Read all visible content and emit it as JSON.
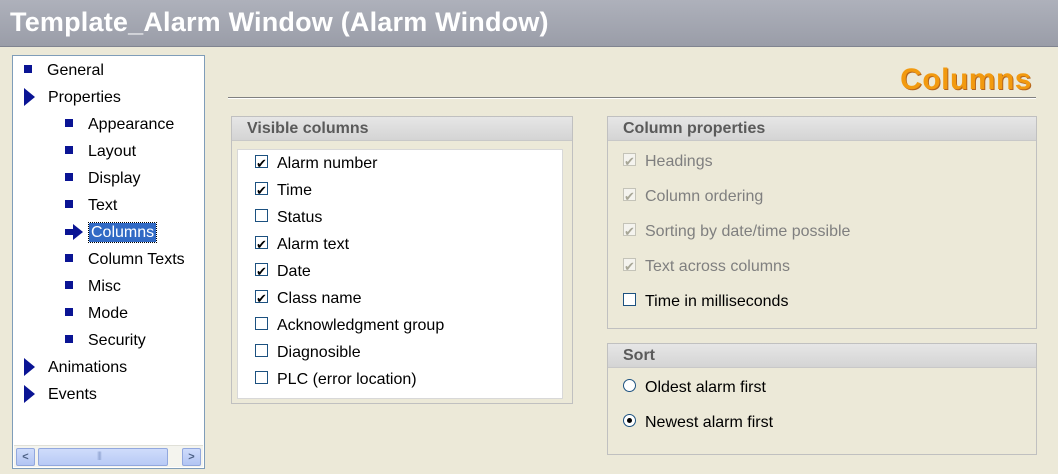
{
  "window": {
    "title": "Template_Alarm Window (Alarm Window)"
  },
  "nav": {
    "items": [
      {
        "label": "General",
        "marker": "bullet",
        "level": 0,
        "selected": false
      },
      {
        "label": "Properties",
        "marker": "triangle",
        "level": 0,
        "selected": false
      },
      {
        "label": "Appearance",
        "marker": "bullet",
        "level": 1,
        "selected": false
      },
      {
        "label": "Layout",
        "marker": "bullet",
        "level": 1,
        "selected": false
      },
      {
        "label": "Display",
        "marker": "bullet",
        "level": 1,
        "selected": false
      },
      {
        "label": "Text",
        "marker": "bullet",
        "level": 1,
        "selected": false
      },
      {
        "label": "Columns",
        "marker": "arrow",
        "level": 1,
        "selected": true
      },
      {
        "label": "Column Texts",
        "marker": "bullet",
        "level": 1,
        "selected": false
      },
      {
        "label": "Misc",
        "marker": "bullet",
        "level": 1,
        "selected": false
      },
      {
        "label": "Mode",
        "marker": "bullet",
        "level": 1,
        "selected": false
      },
      {
        "label": "Security",
        "marker": "bullet",
        "level": 1,
        "selected": false
      },
      {
        "label": "Animations",
        "marker": "triangle",
        "level": 0,
        "selected": false
      },
      {
        "label": "Events",
        "marker": "triangle",
        "level": 0,
        "selected": false
      }
    ],
    "scrollbar": {
      "left_icon": "<",
      "right_icon": ">"
    }
  },
  "main": {
    "section_title": "Columns",
    "visible_columns": {
      "heading": "Visible columns",
      "items": [
        {
          "label": "Alarm number",
          "checked": true
        },
        {
          "label": "Time",
          "checked": true
        },
        {
          "label": "Status",
          "checked": false
        },
        {
          "label": "Alarm text",
          "checked": true
        },
        {
          "label": "Date",
          "checked": true
        },
        {
          "label": "Class name",
          "checked": true
        },
        {
          "label": "Acknowledgment group",
          "checked": false
        },
        {
          "label": "Diagnosible",
          "checked": false
        },
        {
          "label": "PLC (error location)",
          "checked": false
        }
      ]
    },
    "column_properties": {
      "heading": "Column properties",
      "items": [
        {
          "label": "Headings",
          "checked": true,
          "enabled": false
        },
        {
          "label": "Column ordering",
          "checked": true,
          "enabled": false
        },
        {
          "label": "Sorting by date/time possible",
          "checked": true,
          "enabled": false
        },
        {
          "label": "Text across columns",
          "checked": true,
          "enabled": false
        },
        {
          "label": "Time in milliseconds",
          "checked": false,
          "enabled": true
        }
      ]
    },
    "sort": {
      "heading": "Sort",
      "options": [
        {
          "label": "Oldest alarm first",
          "selected": false
        },
        {
          "label": "Newest alarm first",
          "selected": true
        }
      ]
    }
  },
  "colors": {
    "title_bar": "#9a9da8",
    "accent_orange": "#f29a0f",
    "selection": "#316ac5",
    "nav_marker": "#0a1494"
  }
}
